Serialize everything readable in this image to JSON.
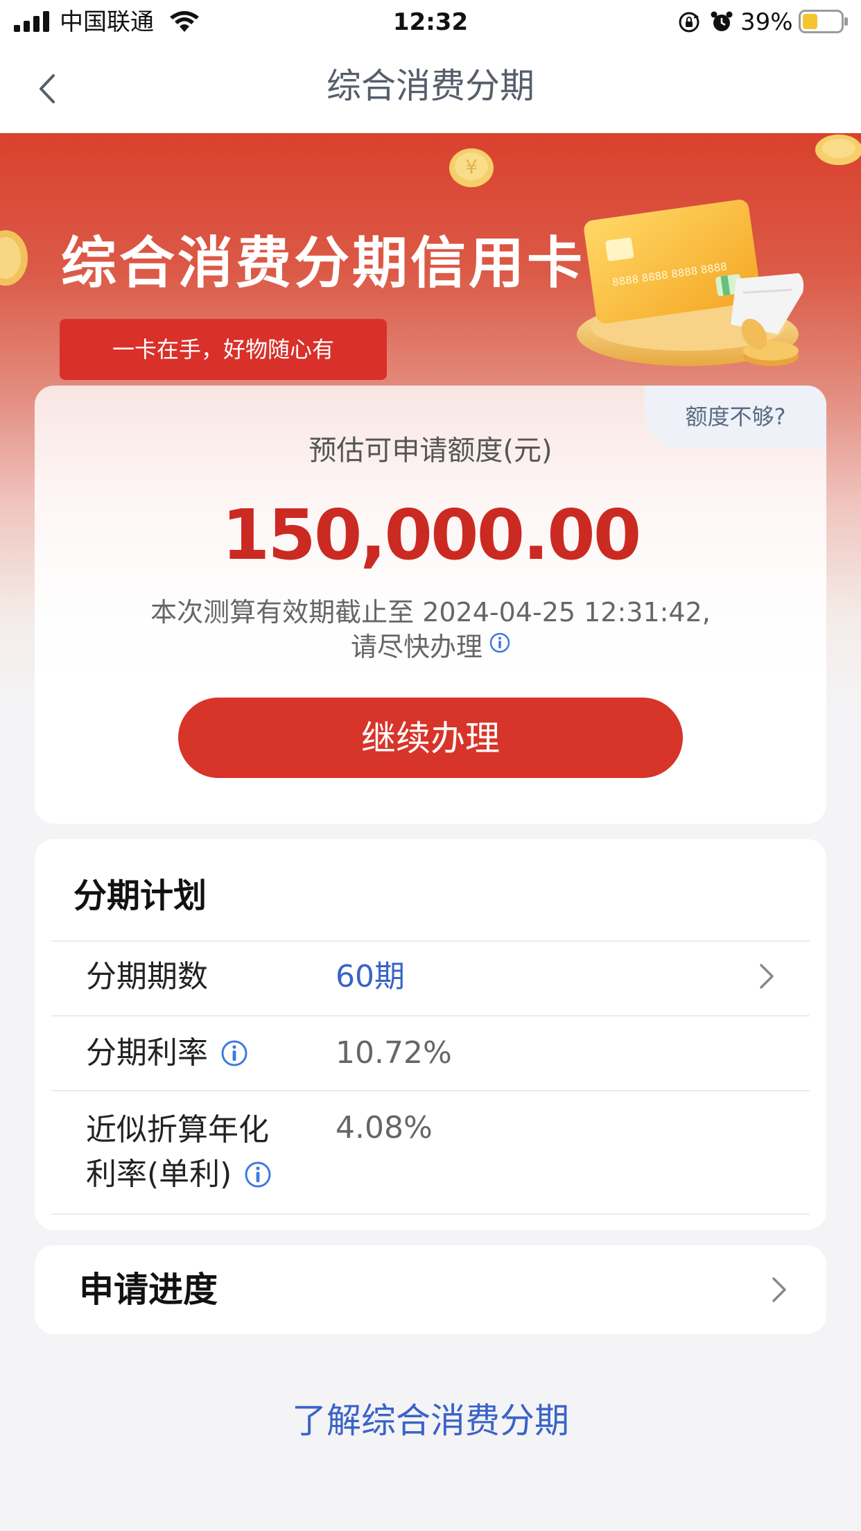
{
  "status_bar": {
    "carrier": "中国联通",
    "time": "12:32",
    "battery": "39%",
    "battery_level": 0.39,
    "icons": [
      "signal-icon",
      "wifi-icon",
      "lock-rotation-icon",
      "alarm-icon",
      "battery-icon"
    ]
  },
  "nav": {
    "back_icon": "chevron-left-icon",
    "title": "综合消费分期"
  },
  "banner": {
    "title": "综合消费分期信用卡",
    "tagline": "一卡在手，好物随心有",
    "card_number_text": "8888 8888 8888 8888"
  },
  "quota": {
    "link": "额度不够?",
    "label": "预估可申请额度(元)",
    "amount": "150,000.00",
    "validity_line1": "本次测算有效期截止至 2024-04-25 12:31:42,",
    "validity_line2": "请尽快办理",
    "button": "继续办理"
  },
  "plan": {
    "title": "分期计划",
    "rows": [
      {
        "label": "分期期数",
        "value": "60期"
      },
      {
        "label": "分期利率",
        "value": "10.72%"
      },
      {
        "label_line1": "近似折算年化",
        "label_line2": "利率(单利)",
        "value": "4.08%"
      }
    ]
  },
  "progress": {
    "title": "申请进度"
  },
  "footer": {
    "learn_more": "了解综合消费分期"
  },
  "colors": {
    "brand_red": "#d7342a",
    "amount_red": "#cb2a22",
    "link_blue": "#3a63c8",
    "info_blue": "#3d7ae0",
    "battery_yellow": "#f5c430"
  }
}
